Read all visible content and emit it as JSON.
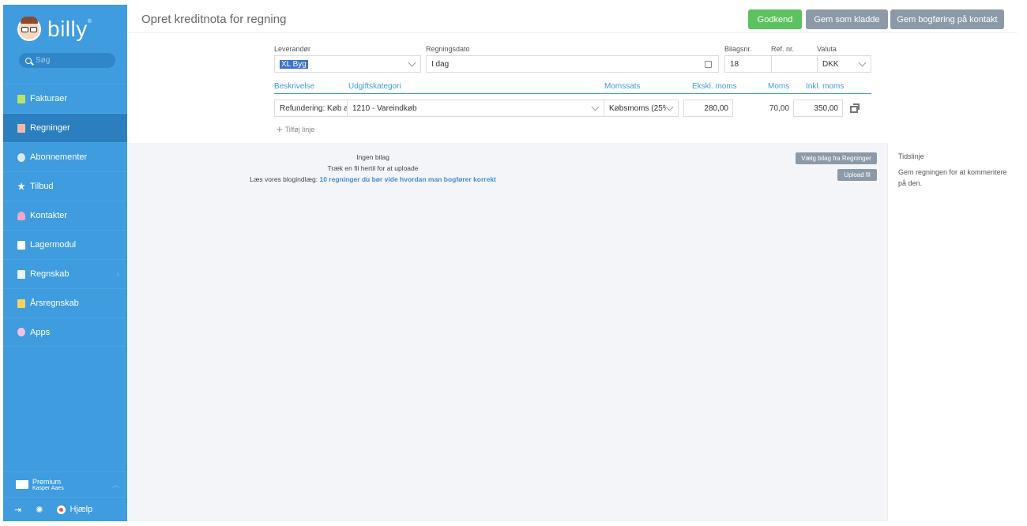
{
  "app": {
    "brand": "billy",
    "brand_mark": "®"
  },
  "search": {
    "placeholder": "Søg"
  },
  "sidebar": {
    "items": [
      {
        "label": "Fakturaer"
      },
      {
        "label": "Regninger"
      },
      {
        "label": "Abonnementer"
      },
      {
        "label": "Tilbud"
      },
      {
        "label": "Kontakter"
      },
      {
        "label": "Lagermodul"
      },
      {
        "label": "Regnskab"
      },
      {
        "label": "Årsregnskab"
      },
      {
        "label": "Apps"
      }
    ],
    "user": {
      "plan": "Premium",
      "name": "Kasper Aaes"
    },
    "footer": {
      "help": "Hjælp"
    }
  },
  "header": {
    "title": "Opret kreditnota for regning",
    "approve": "Godkend",
    "save_draft": "Gem som kladde",
    "save_posting": "Gem bogføring på kontakt"
  },
  "form": {
    "labels": {
      "supplier": "Leverandør",
      "date": "Regningsdato",
      "voucher": "Bilagsnr.",
      "ref": "Ref. nr.",
      "currency": "Valuta"
    },
    "values": {
      "supplier": "XL Byg",
      "date": "I dag",
      "voucher": "18",
      "ref": "",
      "currency": "DKK"
    }
  },
  "lines": {
    "headers": {
      "desc": "Beskrivelse",
      "category": "Udgiftskategori",
      "vat_rate": "Momssats",
      "excl": "Ekskl. moms",
      "vat": "Moms",
      "incl": "Inkl. moms"
    },
    "row": {
      "desc": "Refundering: Køb af",
      "category": "1210 - Vareindkøb",
      "vat_rate": "Købsmoms (25%",
      "excl": "280,00",
      "vat": "70,00",
      "incl": "350,00"
    },
    "add_line": "Tilføj linje"
  },
  "attachments": {
    "none": "Ingen bilag",
    "drag": "Træk en fil hertil for at uploade",
    "blog_prefix": "Læs vores blogindlæg:",
    "blog_link": "10 regninger du bør vide hvordan man bogfører korrekt",
    "choose_btn": "Vælg bilag fra Regninger",
    "upload_btn": "Upload fil"
  },
  "timeline": {
    "title": "Tidslinje",
    "text": "Gem regningen for at kommentere på den."
  }
}
